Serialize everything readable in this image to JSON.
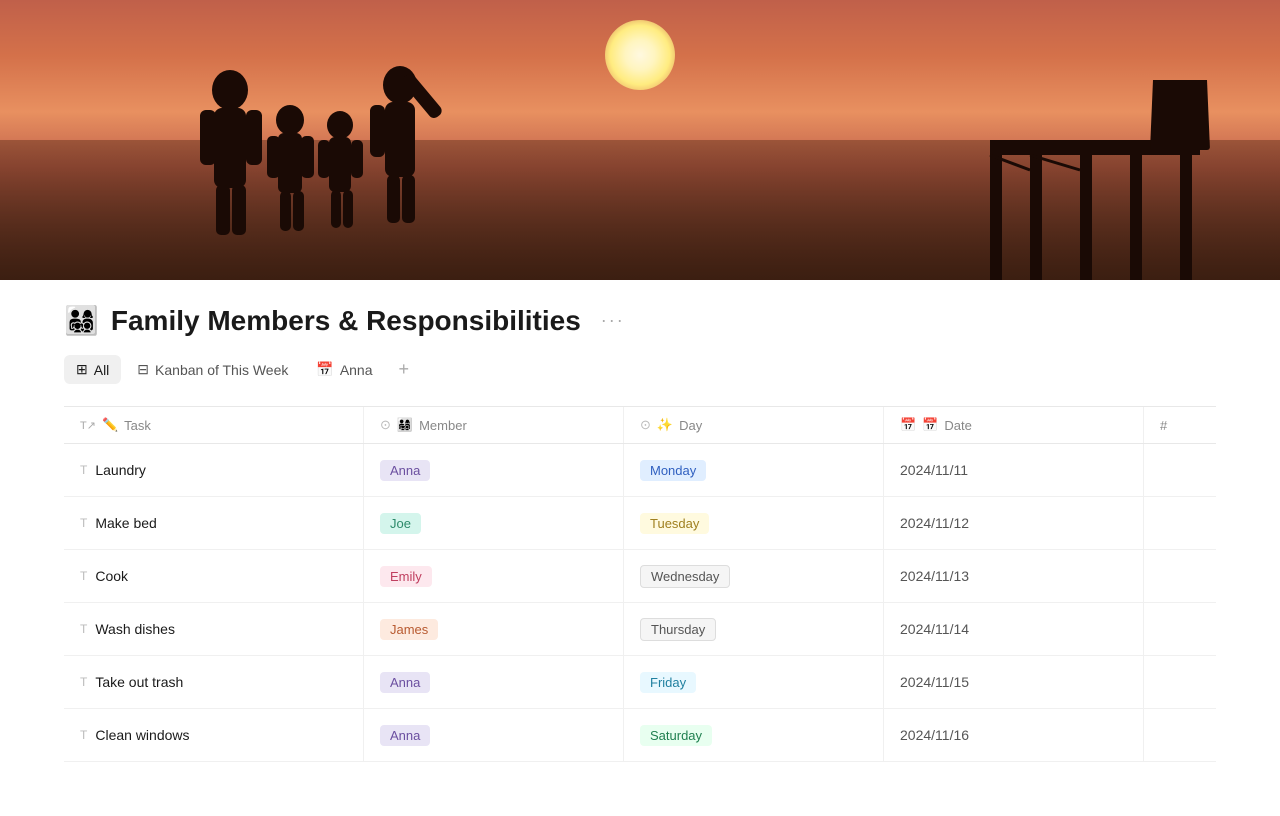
{
  "hero": {
    "alt": "Family silhouette at sunset beach"
  },
  "page": {
    "emoji": "👨‍👩‍👧‍👦",
    "title": "Family Members & Responsibilities",
    "more_label": "···"
  },
  "views": [
    {
      "id": "all",
      "icon": "⊞",
      "label": "All",
      "active": true
    },
    {
      "id": "kanban",
      "icon": "⊟",
      "label": "Kanban of This Week",
      "active": false
    },
    {
      "id": "anna",
      "icon": "📅",
      "label": "Anna",
      "active": false
    }
  ],
  "add_view_label": "+",
  "table": {
    "columns": [
      {
        "id": "task",
        "icon": "T↗",
        "emoji": "✏️",
        "label": "Task"
      },
      {
        "id": "member",
        "icon": "⊙",
        "emoji": "👨‍👩‍👧‍👦",
        "label": "Member"
      },
      {
        "id": "day",
        "icon": "⊙",
        "emoji": "✨",
        "label": "Day"
      },
      {
        "id": "date",
        "icon": "📅",
        "emoji": "📅",
        "label": "Date"
      },
      {
        "id": "hash",
        "label": "#"
      }
    ],
    "rows": [
      {
        "task": "Laundry",
        "member": "Anna",
        "member_class": "tag-anna",
        "day": "Monday",
        "day_class": "day-monday",
        "date": "2024/11/11"
      },
      {
        "task": "Make bed",
        "member": "Joe",
        "member_class": "tag-joe",
        "day": "Tuesday",
        "day_class": "day-tuesday",
        "date": "2024/11/12"
      },
      {
        "task": "Cook",
        "member": "Emily",
        "member_class": "tag-emily",
        "day": "Wednesday",
        "day_class": "day-wednesday",
        "date": "2024/11/13"
      },
      {
        "task": "Wash dishes",
        "member": "James",
        "member_class": "tag-james",
        "day": "Thursday",
        "day_class": "day-thursday",
        "date": "2024/11/14"
      },
      {
        "task": "Take out trash",
        "member": "Anna",
        "member_class": "tag-anna",
        "day": "Friday",
        "day_class": "day-friday",
        "date": "2024/11/15"
      },
      {
        "task": "Clean windows",
        "member": "Anna",
        "member_class": "tag-anna",
        "day": "Saturday",
        "day_class": "day-saturday",
        "date": "2024/11/16"
      }
    ]
  }
}
